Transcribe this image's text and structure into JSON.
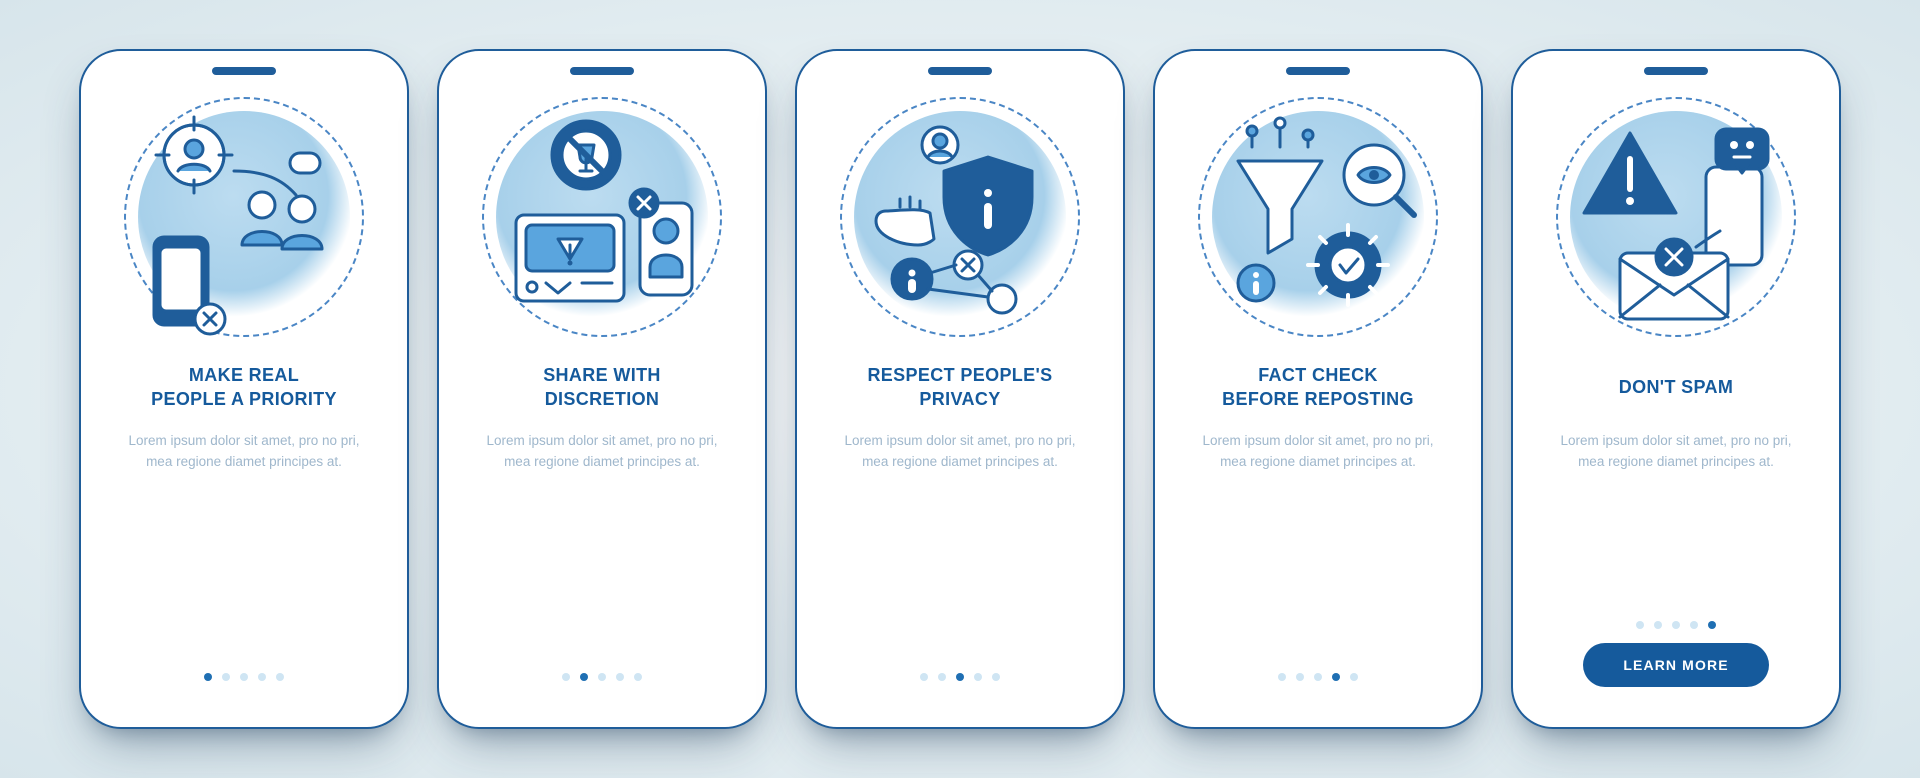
{
  "colors": {
    "primary": "#155a9c",
    "stroke": "#1f5d9a",
    "accent_light": "#a7d0ea",
    "dot_inactive": "#cfe5f3",
    "text_muted": "#9fb7cc"
  },
  "screens": [
    {
      "icon": "people-priority-icon",
      "title": "MAKE REAL\nPEOPLE A PRIORITY",
      "description": "Lorem ipsum dolor sit amet, pro no pri, mea regione diamet principes at.",
      "active_dot": 0,
      "show_cta": false
    },
    {
      "icon": "share-discretion-icon",
      "title": "SHARE WITH\nDISCRETION",
      "description": "Lorem ipsum dolor sit amet, pro no pri, mea regione diamet principes at.",
      "active_dot": 1,
      "show_cta": false
    },
    {
      "icon": "privacy-icon",
      "title": "RESPECT PEOPLE'S\nPRIVACY",
      "description": "Lorem ipsum dolor sit amet, pro no pri, mea regione diamet principes at.",
      "active_dot": 2,
      "show_cta": false
    },
    {
      "icon": "fact-check-icon",
      "title": "FACT CHECK\nBEFORE REPOSTING",
      "description": "Lorem ipsum dolor sit amet, pro no pri, mea regione diamet principes at.",
      "active_dot": 3,
      "show_cta": false
    },
    {
      "icon": "dont-spam-icon",
      "title": "DON'T SPAM",
      "description": "Lorem ipsum dolor sit amet, pro no pri, mea regione diamet principes at.",
      "active_dot": 4,
      "show_cta": true
    }
  ],
  "dot_count": 5,
  "cta_label": "LEARN MORE"
}
